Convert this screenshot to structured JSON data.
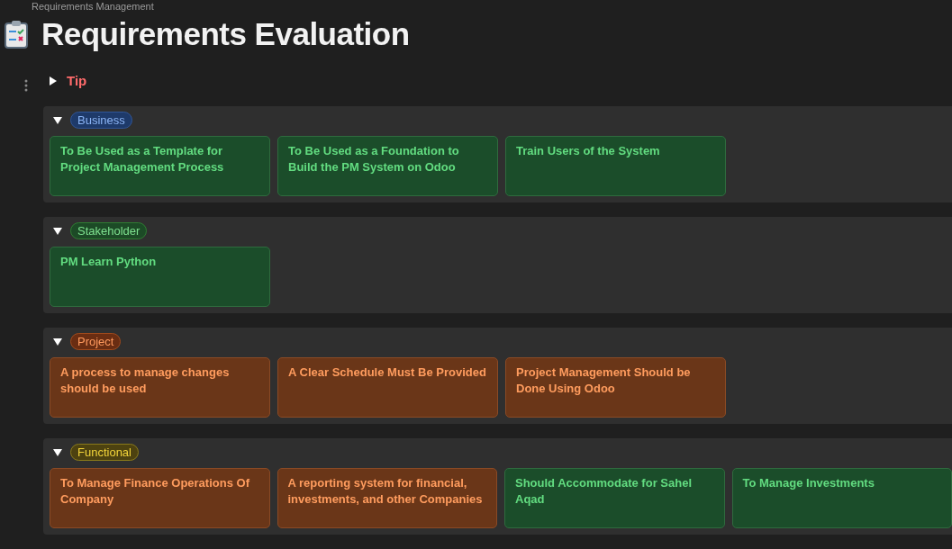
{
  "breadcrumb": "Requirements Management",
  "title": "Requirements Evaluation",
  "tip": {
    "label": "Tip",
    "expanded": false
  },
  "groups": [
    {
      "tag": "Business",
      "color": "#2f5597",
      "expanded": true,
      "cards": [
        {
          "text": "To Be Used as a Template for Project Management Process",
          "color": "#1b4d2a"
        },
        {
          "text": "To Be Used as a Foundation to Build the PM System on Odoo",
          "color": "#1b4d2a"
        },
        {
          "text": "Train Users of the System",
          "color": "#1b4d2a"
        }
      ]
    },
    {
      "tag": "Stakeholder",
      "color": "#2e7d32",
      "expanded": true,
      "cards": [
        {
          "text": "PM Learn Python",
          "color": "#1b4d2a"
        }
      ]
    },
    {
      "tag": "Project",
      "color": "#a04a1c",
      "expanded": true,
      "cards": [
        {
          "text": "A process to manage changes should be used",
          "color": "#6a3618"
        },
        {
          "text": "A Clear Schedule Must Be Provided",
          "color": "#6a3618"
        },
        {
          "text": "Project Management Should be Done Using Odoo",
          "color": "#6a3618"
        }
      ]
    },
    {
      "tag": "Functional",
      "color": "#8a7a1a",
      "expanded": true,
      "cards": [
        {
          "text": "To Manage Finance Operations Of Company",
          "color": "#6a3618"
        },
        {
          "text": "A reporting system for financial, investments, and other Companies",
          "color": "#6a3618"
        },
        {
          "text": "Should Accommodate for Sahel Aqad",
          "color": "#1b4d2a"
        },
        {
          "text": "To Manage Investments",
          "color": "#1b4d2a"
        }
      ]
    }
  ]
}
